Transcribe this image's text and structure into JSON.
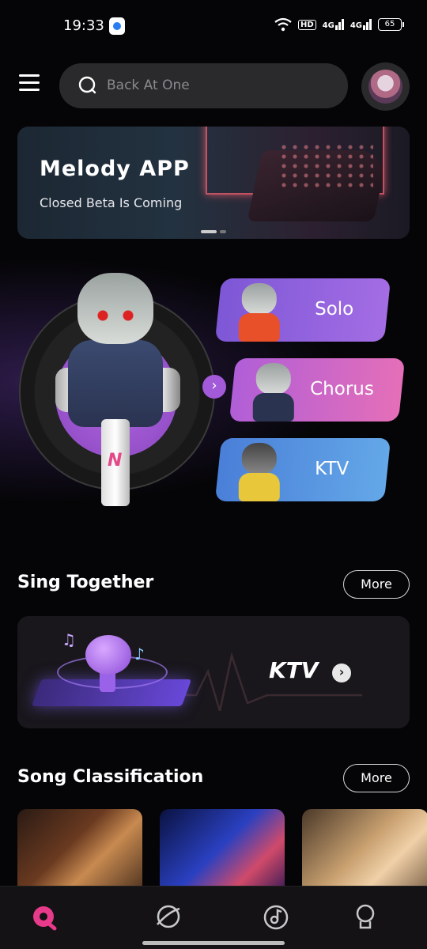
{
  "status_bar": {
    "time": "19:33",
    "hd": "HD",
    "sig1": "4G",
    "sig2": "4G",
    "battery": "65"
  },
  "header": {
    "search_placeholder": "Back At One",
    "menu_icon": "hamburger-icon",
    "search_icon": "search-icon"
  },
  "banner": {
    "title": "Melody APP",
    "subtitle": "Closed Beta Is Coming"
  },
  "modes": {
    "solo": "Solo",
    "chorus": "Chorus",
    "ktv": "KTV"
  },
  "sing_together": {
    "title": "Sing Together",
    "more": "More",
    "card_label": "KTV"
  },
  "song_classification": {
    "title": "Song Classification",
    "more": "More"
  },
  "bottom_nav": {
    "items": [
      "home-icon",
      "planet-icon",
      "music-disc-icon",
      "profile-icon"
    ],
    "active_color": "#e83a8a"
  },
  "colors": {
    "accent": "#a35ad8",
    "solo": "#8a60dc",
    "chorus": "#d266c8",
    "ktv": "#5a96e0"
  }
}
